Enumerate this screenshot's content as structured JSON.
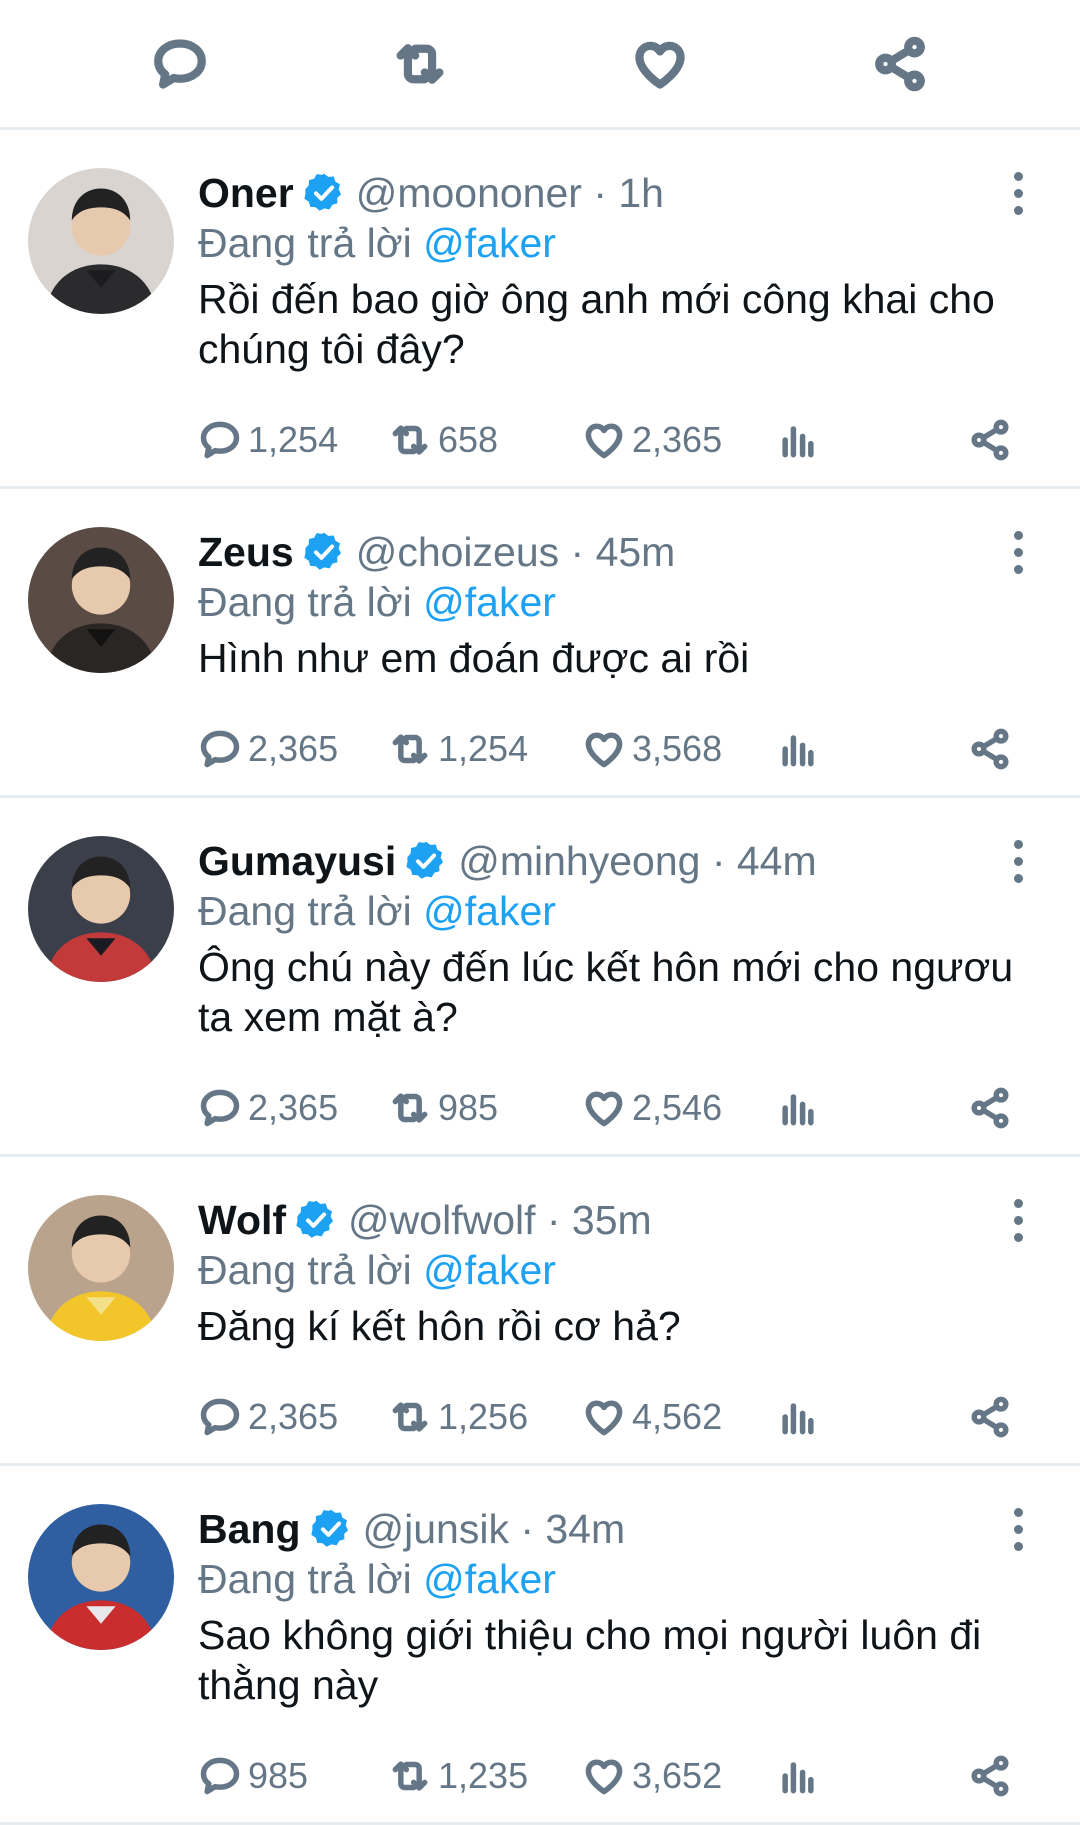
{
  "top_actions": [
    "reply-icon",
    "retweet-icon",
    "like-icon",
    "share-icon"
  ],
  "colors": {
    "accent": "#1da1f2",
    "muted": "#657786",
    "divider": "#e6ecf0"
  },
  "tweets": [
    {
      "name": "Oner",
      "handle_time": "@moononer · 1h",
      "replying_prefix": "Đang trả lời ",
      "replying_to": "@faker",
      "text": "Rồi đến bao giờ ông anh mới công khai cho chúng tôi đây?",
      "replies": "1,254",
      "retweets": "658",
      "likes": "2,365"
    },
    {
      "name": "Zeus",
      "handle_time": "@choizeus · 45m",
      "replying_prefix": "Đang trả lời ",
      "replying_to": "@faker",
      "text": "Hình như em đoán được ai rồi",
      "replies": "2,365",
      "retweets": "1,254",
      "likes": "3,568"
    },
    {
      "name": "Gumayusi",
      "handle_time": "@minhyeong · 44m",
      "replying_prefix": "Đang trả lời ",
      "replying_to": "@faker",
      "text": "Ông chú này đến lúc kết hôn mới cho ngươu ta xem mặt à?",
      "replies": "2,365",
      "retweets": "985",
      "likes": "2,546"
    },
    {
      "name": "Wolf",
      "handle_time": "@wolfwolf · 35m",
      "replying_prefix": "Đang trả lời ",
      "replying_to": "@faker",
      "text": "Đăng kí kết hôn rồi cơ hả?",
      "replies": "2,365",
      "retweets": "1,256",
      "likes": "4,562"
    },
    {
      "name": "Bang",
      "handle_time": "@junsik · 34m",
      "replying_prefix": "Đang trả lời ",
      "replying_to": "@faker",
      "text": "Sao không giới thiệu cho mọi người luôn đi thằng này",
      "replies": "985",
      "retweets": "1,235",
      "likes": "3,652"
    }
  ]
}
